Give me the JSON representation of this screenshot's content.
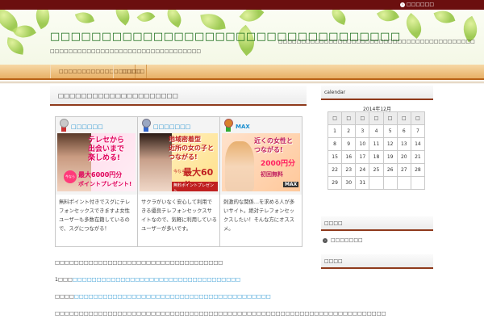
{
  "topbar": {
    "link_label": "□□□□□□"
  },
  "header": {
    "site_title": "□□□□□□□□□□□□□□□□□□□□□□□□□□□□□□□□□□",
    "site_description": "□□□□□□□□□□□□□□□□□□□□□□□□□□□□□□□□□",
    "right_text": "□□□□□□□□□□□□□□□□□□□□□□□□□□□□□□□□□□□□□□□□□□□"
  },
  "nav": {
    "items": [
      {
        "label": "□□□□□□□□□□□□□□□□□□"
      },
      {
        "label": "□□□□□"
      }
    ]
  },
  "article": {
    "title": "□□□□□□□□□□□□□□□□□□□□□",
    "cards": [
      {
        "name": "□□□□□□",
        "name_color": "#1a8ecf",
        "medal_color": "#c9c9c9",
        "banner_line1": "テレセから",
        "banner_line2": "出会いまで",
        "banner_line3": "楽しめる!",
        "banner_badge": "今なら",
        "banner_amount": "最大6000円分",
        "banner_point": "ポイントプレゼント!",
        "text": "無料ポイント付きでスグにテレフォンセックスできますよ女性ユーザーも多数在籍しているので、スグにつながる！"
      },
      {
        "name": "□□□□□□□",
        "name_color": "#1a8ecf",
        "medal_color": "#9aa7c2",
        "banner_line1": "地域密着型",
        "banner_line2": "近所の女の子と",
        "banner_line3": "つながる!",
        "banner_badge": "今なら",
        "banner_amount": "最大60分",
        "banner_point": "無料ポイントプレゼント",
        "text": "サクラがいなく安心して利用できる優良テレフォンセックスサイトなので、気軽に利用しているユーザーが多いです。"
      },
      {
        "name": "MAX",
        "name_color": "#1a8ecf",
        "medal_color": "#d9812c",
        "banner_line1": "近くの女性と",
        "banner_line2": "つながる!",
        "banner_line3": "",
        "banner_badge": "2000円分",
        "banner_amount": "初回無料",
        "banner_point": "MAX",
        "text": "刺激的な関係…を求める人が多いサイト。絶対テレフォンセックスしたい！そんな方にオススメ。"
      }
    ],
    "paragraphs": [
      {
        "prefix": "□□□□□□□□□□□□□□□□□□□□□□□□□□□□□□□□□□□",
        "link": ""
      },
      {
        "prefix": "1□□□",
        "link": "□□□□□□□□□□□□□□□□□□□□□□□□□□□□□□□□□□□"
      },
      {
        "prefix": "□□□□",
        "link": "□□□□□□□□□□□□□□□□□□□□□□□□□□□□□□□□□□□□□□□□□"
      },
      {
        "prefix": "□□□□□□□□□□□□□□□□□□□□□□□□□□□□□□□□□□□□□□□□□□□□□□□□□□□□□□□□□□□□□□□□□□□□□",
        "link": ""
      }
    ]
  },
  "sidebar": {
    "calendar_heading": "calendar",
    "calendar_caption": "2014年12月",
    "weekday_headers": [
      "□",
      "□",
      "□",
      "□",
      "□",
      "□",
      "□"
    ],
    "weeks": [
      [
        "1",
        "2",
        "3",
        "4",
        "5",
        "6",
        "7"
      ],
      [
        "8",
        "9",
        "10",
        "11",
        "12",
        "13",
        "14"
      ],
      [
        "15",
        "16",
        "17",
        "18",
        "19",
        "20",
        "21"
      ],
      [
        "22",
        "23",
        "24",
        "25",
        "26",
        "27",
        "28"
      ],
      [
        "29",
        "30",
        "31",
        "",
        "",
        "",
        ""
      ]
    ],
    "section2_heading": "□□□□",
    "section2_link": "□□□□□□□",
    "section3_heading": "□□□□"
  },
  "colors": {
    "topbar": "#6b0f0f",
    "title": "#176b17",
    "link": "#1a8ecf",
    "accent_border": "#8f3a1c"
  }
}
